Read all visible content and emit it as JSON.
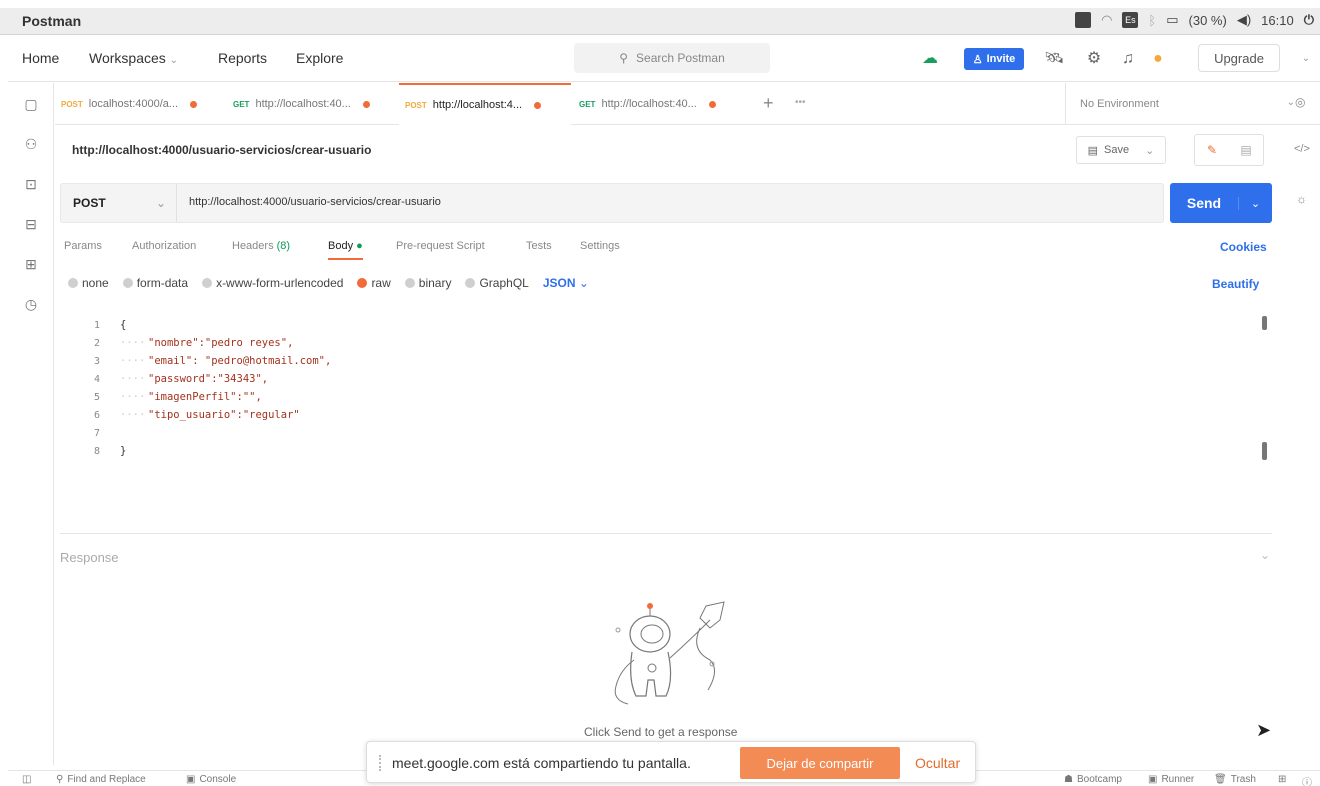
{
  "os": {
    "app_title": "Postman",
    "battery": "(30 %)",
    "time": "16:10",
    "keyboard": "Es"
  },
  "header": {
    "nav": [
      "Home",
      "Workspaces",
      "Reports",
      "Explore"
    ],
    "search_placeholder": "Search Postman",
    "invite": "Invite",
    "upgrade": "Upgrade"
  },
  "tabs": [
    {
      "method": "POST",
      "label": "localhost:4000/a..."
    },
    {
      "method": "GET",
      "label": "http://localhost:40..."
    },
    {
      "method": "POST",
      "label": "http://localhost:4..."
    },
    {
      "method": "GET",
      "label": "http://localhost:40..."
    }
  ],
  "environment": "No Environment",
  "request": {
    "title": "http://localhost:4000/usuario-servicios/crear-usuario",
    "method": "POST",
    "url": "http://localhost:4000/usuario-servicios/crear-usuario",
    "send": "Send",
    "save": "Save"
  },
  "req_tabs": {
    "params": "Params",
    "authorization": "Authorization",
    "headers": "Headers",
    "headers_count": "(8)",
    "body": "Body",
    "prerequest": "Pre-request Script",
    "tests": "Tests",
    "settings": "Settings",
    "cookies": "Cookies"
  },
  "body_types": {
    "none": "none",
    "form_data": "form-data",
    "urlencoded": "x-www-form-urlencoded",
    "raw": "raw",
    "binary": "binary",
    "graphql": "GraphQL",
    "format": "JSON",
    "beautify": "Beautify"
  },
  "code": {
    "line_numbers": [
      "1",
      "2",
      "3",
      "4",
      "5",
      "6",
      "7",
      "8"
    ],
    "lines": [
      "{",
      "\"nombre\":\"pedro reyes\",",
      "\"email\": \"pedro@hotmail.com\",",
      "\"password\":\"34343\",",
      "\"imagenPerfil\":\"\",",
      "\"tipo_usuario\":\"regular\"",
      "",
      "}"
    ]
  },
  "response": {
    "label": "Response",
    "empty_message": "Click Send to get a response"
  },
  "statusbar": {
    "find_replace": "Find and Replace",
    "console": "Console",
    "bootcamp": "Bootcamp",
    "runner": "Runner",
    "trash": "Trash"
  },
  "share_banner": {
    "message": "meet.google.com está compartiendo tu pantalla.",
    "stop": "Dejar de compartir",
    "hide": "Ocultar"
  },
  "colors": {
    "accent": "#f26b3a",
    "primary": "#2f6feb",
    "share_button": "#f28b54"
  }
}
